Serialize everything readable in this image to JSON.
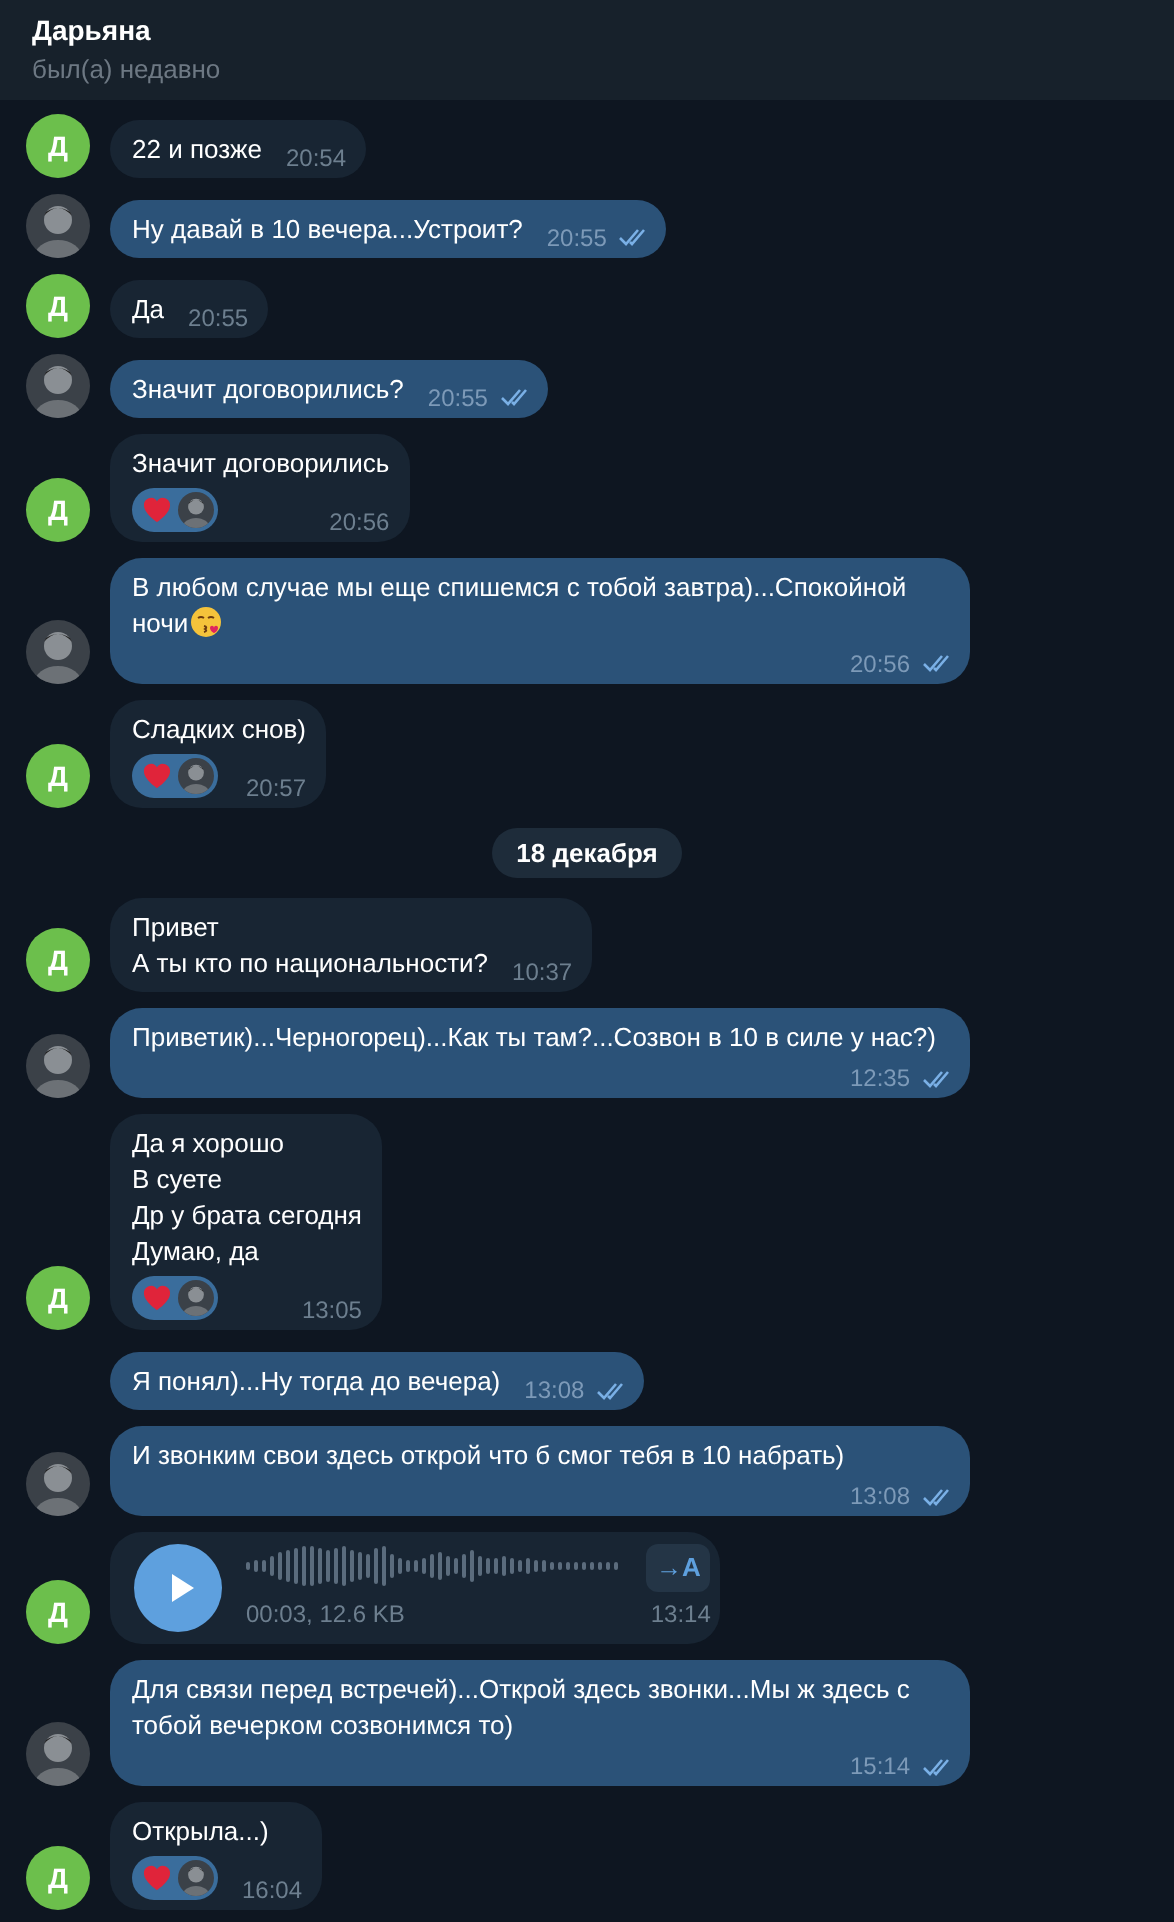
{
  "header": {
    "title": "Дарьяна",
    "status": "был(а) недавно"
  },
  "messages": [
    {
      "kind": "incoming",
      "text": "22 и позже",
      "time": "20:54",
      "avatar_letter": "Д"
    },
    {
      "kind": "outgoing",
      "text": "Ну давай в 10 вечера...Устроит?",
      "time": "20:55",
      "read": true,
      "avatar": true
    },
    {
      "kind": "incoming",
      "text": "Да",
      "time": "20:55",
      "avatar_letter": "Д"
    },
    {
      "kind": "outgoing",
      "text": "Значит договорились?",
      "time": "20:55",
      "read": true,
      "avatar": true
    },
    {
      "kind": "incoming",
      "text": "Значит договорились",
      "time": "20:56",
      "reacted": true,
      "avatar_letter": "Д"
    },
    {
      "kind": "outgoing",
      "text": "В любом случае мы еще спишемся с тобой завтра)...Спокойной ночи",
      "has_emoji": true,
      "time": "20:56",
      "read": true,
      "avatar": true
    },
    {
      "kind": "incoming",
      "text": "Сладких снов)",
      "time": "20:57",
      "reacted": true,
      "avatar_letter": "Д"
    },
    {
      "kind": "date",
      "text": "18 декабря"
    },
    {
      "kind": "incoming",
      "text": "Привет\nА ты кто по национальности?",
      "time": "10:37",
      "avatar_letter": "Д"
    },
    {
      "kind": "outgoing",
      "text": "Приветик)...Черногорец)...Как ты там?...Созвон в 10 в силе у нас?)",
      "time": "12:35",
      "read": true,
      "avatar": true
    },
    {
      "kind": "incoming",
      "text": "Да я хорошо\nВ суете\nДр у брата сегодня\nДумаю, да",
      "time": "13:05",
      "reacted": true,
      "avatar_letter": "Д"
    },
    {
      "kind": "outgoing",
      "text": "Я понял)...Ну тогда до вечера)",
      "time": "13:08",
      "read": true,
      "avatar": false
    },
    {
      "kind": "outgoing",
      "text": "И звонким свои здесь открой что б смог тебя в 10 набрать)",
      "time": "13:08",
      "read": true,
      "avatar": true
    },
    {
      "kind": "incoming_voice",
      "info": "00:03, 12.6 KB",
      "transcribe": "→A",
      "time": "13:14",
      "avatar_letter": "Д"
    },
    {
      "kind": "outgoing",
      "text": "Для связи перед встречей)...Открой здесь звонки...Мы ж здесь с тобой вечерком созвонимся то)",
      "time": "15:14",
      "read": true,
      "avatar": true
    },
    {
      "kind": "incoming",
      "text": "Открыла...)",
      "time": "16:04",
      "reacted": true,
      "avatar_letter": "Д"
    }
  ]
}
